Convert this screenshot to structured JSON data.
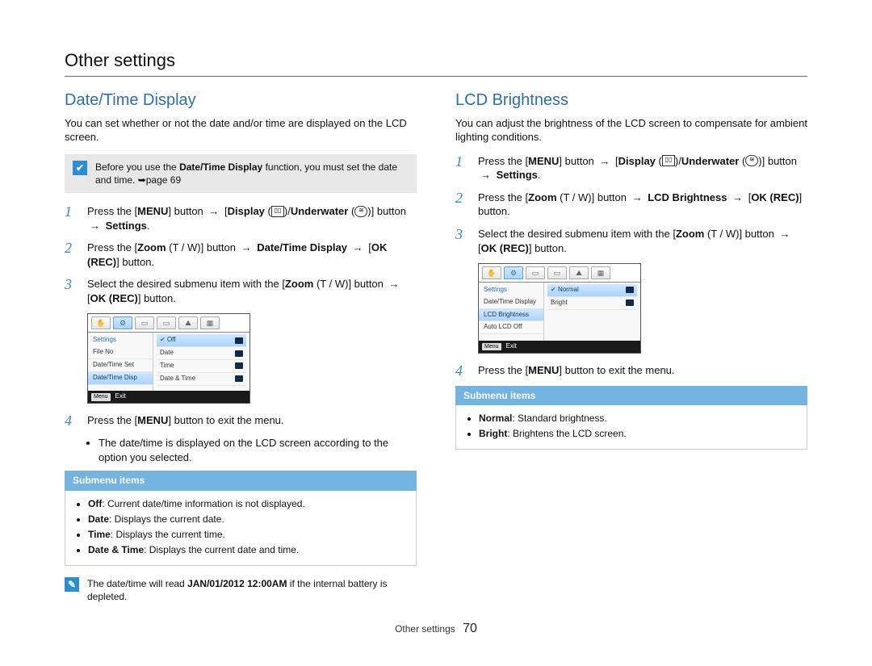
{
  "pageTitle": "Other settings",
  "footer": {
    "label": "Other settings",
    "page": "70"
  },
  "left": {
    "title": "Date/Time Display",
    "intro": "You can set whether or not the date and/or time are displayed on the LCD screen.",
    "note": {
      "pre": "Before you use the ",
      "bold": "Date/Time Display",
      "post": " function, you must set the date and time. ➥page 69"
    },
    "steps": {
      "s1": {
        "n": "1",
        "a": "Press the [",
        "menu": "MENU",
        "b": "] button ",
        "arrow": "→",
        "c": " [",
        "display": "Display",
        "d": " (",
        "e": ")/",
        "under": "Underwater",
        "f": " (",
        "g": ")] button ",
        "arrow2": "→",
        "settings": " Settings",
        "end": "."
      },
      "s2": {
        "n": "2",
        "a": "Press the [",
        "zoom": "Zoom",
        "tw": " (T / W)",
        "b": "] button ",
        "arrow": "→",
        "dt": " Date/Time Display",
        "arrow2": " →",
        "c": " [",
        "ok": "OK (REC)",
        "d": "] button."
      },
      "s3": {
        "n": "3",
        "a": "Select the desired submenu item with the [",
        "zoom": "Zoom",
        "tw": " (T / W)",
        "b": "] button ",
        "arrow": "→",
        "c": " [",
        "ok": "OK (REC)",
        "d": "] button."
      },
      "s4": {
        "n": "4",
        "a": "Press the [",
        "menu": "MENU",
        "b": "] button to exit the menu."
      },
      "s4bullet": "The date/time is displayed on the LCD screen according to the option you selected."
    },
    "screenshot": {
      "leftTitle": "Settings",
      "leftRows": [
        "File No",
        "Date/Time Set",
        "Date/Time Disp"
      ],
      "rightRows": [
        "Off",
        "Date",
        "Time",
        "Date & Time"
      ],
      "footerBtn": "Menu",
      "footerExit": "Exit"
    },
    "submenuTitle": "Submenu items",
    "submenu": [
      {
        "b": "Off",
        "t": ": Current date/time information is not displayed."
      },
      {
        "b": "Date",
        "t": ": Displays the current date."
      },
      {
        "b": "Time",
        "t": ": Displays the current time."
      },
      {
        "b": "Date & Time",
        "t": ": Displays the current date and time."
      }
    ],
    "footNote": {
      "a": "The date/time will read ",
      "bold": "JAN/01/2012 12:00AM",
      "b": " if the internal battery is depleted."
    }
  },
  "right": {
    "title": "LCD Brightness",
    "intro": "You can adjust the brightness of the LCD screen to compensate for ambient lighting conditions.",
    "steps": {
      "s1": {
        "n": "1",
        "a": "Press the [",
        "menu": "MENU",
        "b": "] button ",
        "arrow": "→",
        "c": " [",
        "display": "Display",
        "d": " (",
        "e": ")/",
        "under": "Underwater",
        "f": " (",
        "g": ")] button ",
        "arrow2": "→",
        "settings": " Settings",
        "end": "."
      },
      "s2": {
        "n": "2",
        "a": "Press the [",
        "zoom": "Zoom",
        "tw": " (T / W)",
        "b": "] button ",
        "arrow": "→",
        "lcd": " LCD Brightness",
        "arrow2": " →",
        "c": " [",
        "ok": "OK (REC)",
        "d": "] button."
      },
      "s3": {
        "n": "3",
        "a": "Select the desired submenu item with the [",
        "zoom": "Zoom",
        "tw": " (T / W)",
        "b": "] button ",
        "arrow": "→",
        "c": " [",
        "ok": "OK (REC)",
        "d": "] button."
      },
      "s4": {
        "n": "4",
        "a": "Press the [",
        "menu": "MENU",
        "b": "] button to exit the menu."
      }
    },
    "screenshot": {
      "leftTitle": "Settings",
      "leftRows": [
        "Date/Time Display",
        "LCD Brightness",
        "Auto LCD Off"
      ],
      "rightRows": [
        "Normal",
        "Bright"
      ],
      "footerBtn": "Menu",
      "footerExit": "Exit"
    },
    "submenuTitle": "Submenu items",
    "submenu": [
      {
        "b": "Normal",
        "t": ": Standard brightness."
      },
      {
        "b": "Bright",
        "t": ": Brightens the LCD screen."
      }
    ]
  }
}
